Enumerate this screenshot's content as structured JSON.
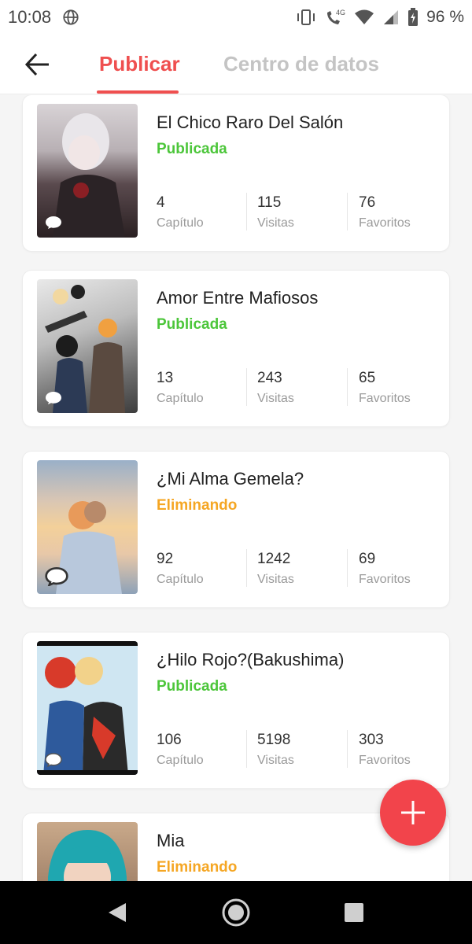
{
  "status_bar": {
    "time": "10:08",
    "network_label": "4G",
    "battery_text": "96 %"
  },
  "header": {
    "back_icon": "arrow-left-icon",
    "tabs": [
      {
        "label": "Publicar",
        "active": true
      },
      {
        "label": "Centro de datos",
        "active": false
      }
    ]
  },
  "stories": [
    {
      "title": "El Chico Raro Del Salón",
      "status": "Publicada",
      "status_kind": "published",
      "stats": [
        {
          "value": "4",
          "label": "Capítulo"
        },
        {
          "value": "115",
          "label": "Visitas"
        },
        {
          "value": "76",
          "label": "Favoritos"
        }
      ]
    },
    {
      "title": "Amor Entre Mafiosos",
      "status": "Publicada",
      "status_kind": "published",
      "stats": [
        {
          "value": "13",
          "label": "Capítulo"
        },
        {
          "value": "243",
          "label": "Visitas"
        },
        {
          "value": "65",
          "label": "Favoritos"
        }
      ]
    },
    {
      "title": "¿Mi Alma Gemela?",
      "status": "Eliminando",
      "status_kind": "deleting",
      "stats": [
        {
          "value": "92",
          "label": "Capítulo"
        },
        {
          "value": "1242",
          "label": "Visitas"
        },
        {
          "value": "69",
          "label": "Favoritos"
        }
      ]
    },
    {
      "title": "¿Hilo Rojo?(Bakushima)",
      "status": "Publicada",
      "status_kind": "published",
      "stats": [
        {
          "value": "106",
          "label": "Capítulo"
        },
        {
          "value": "5198",
          "label": "Visitas"
        },
        {
          "value": "303",
          "label": "Favoritos"
        }
      ]
    },
    {
      "title": "Mia",
      "status": "Eliminando",
      "status_kind": "deleting",
      "stats": []
    }
  ],
  "fab": {
    "icon": "plus-icon"
  },
  "colors": {
    "accent": "#ef4f4f",
    "published": "#4cc63a",
    "deleting": "#f5a623",
    "fab": "#f2444b"
  }
}
